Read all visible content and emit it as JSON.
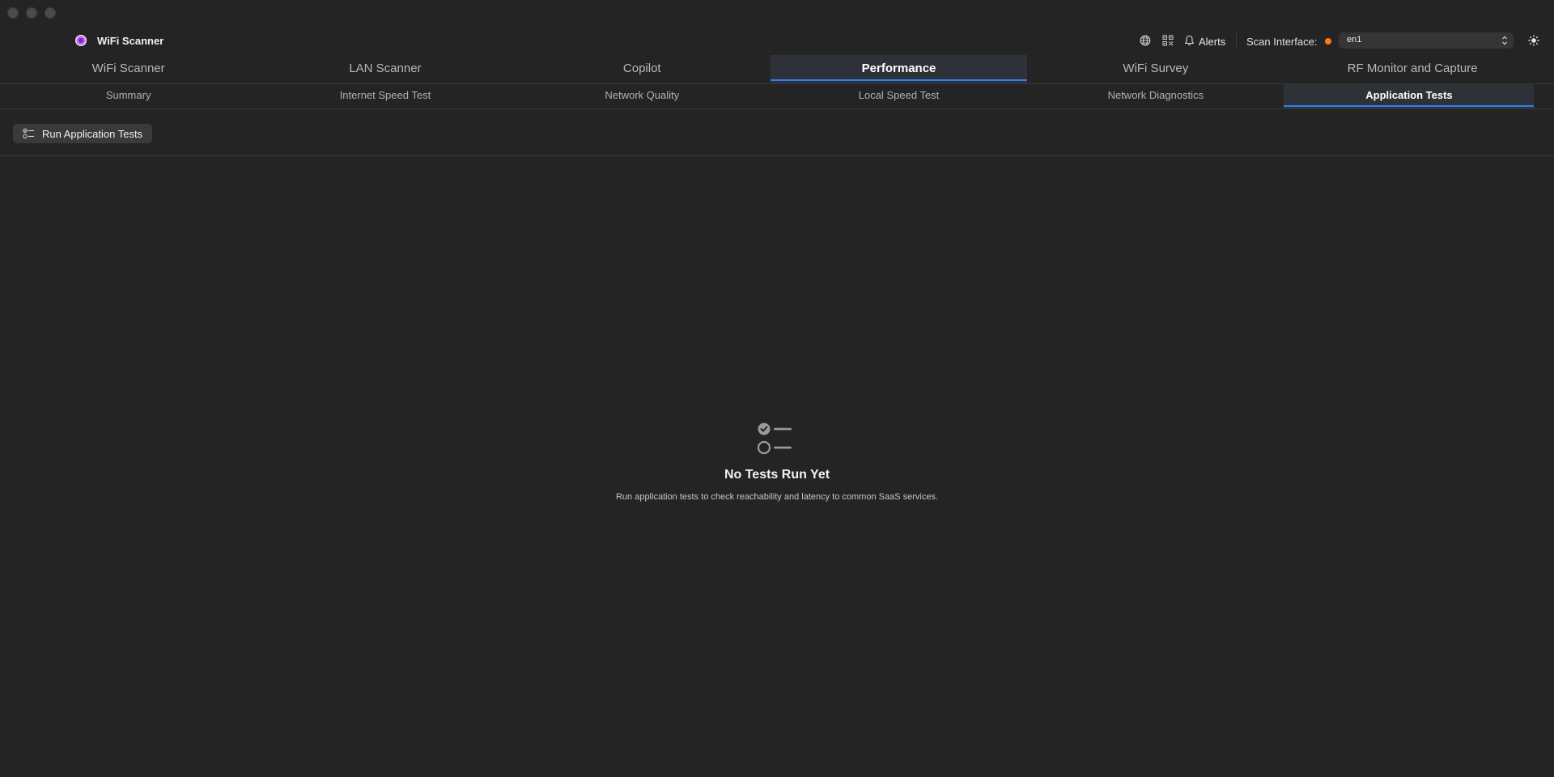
{
  "app": {
    "title": "WiFi Scanner"
  },
  "toolbar": {
    "globe_icon": "globe-icon",
    "qr_icon": "qr-code-icon",
    "bell_icon": "bell-icon",
    "alerts_label": "Alerts",
    "scan_interface_label": "Scan Interface:",
    "interface_status_color": "#ff7a1a",
    "interface_value": "en1",
    "theme_icon": "sun-icon"
  },
  "main_tabs": [
    {
      "label": "WiFi Scanner",
      "active": false
    },
    {
      "label": "LAN Scanner",
      "active": false
    },
    {
      "label": "Copilot",
      "active": false
    },
    {
      "label": "Performance",
      "active": true
    },
    {
      "label": "WiFi Survey",
      "active": false
    },
    {
      "label": "RF Monitor and Capture",
      "active": false
    }
  ],
  "sub_tabs": [
    {
      "label": "Summary",
      "active": false
    },
    {
      "label": "Internet Speed Test",
      "active": false
    },
    {
      "label": "Network Quality",
      "active": false
    },
    {
      "label": "Local Speed Test",
      "active": false
    },
    {
      "label": "Network Diagnostics",
      "active": false
    },
    {
      "label": "Application Tests",
      "active": true
    }
  ],
  "actions": {
    "run_button_label": "Run Application Tests",
    "run_button_icon": "checklist-icon"
  },
  "empty_state": {
    "icon": "checklist-icon",
    "title": "No Tests Run Yet",
    "subtitle": "Run application tests to check reachability and latency to common SaaS services."
  },
  "colors": {
    "accent": "#2d7ff9",
    "background": "#242424"
  }
}
